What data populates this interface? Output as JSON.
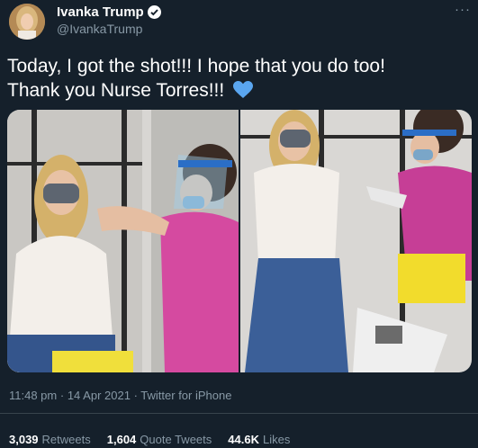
{
  "author": {
    "name": "Ivanka Trump",
    "handle": "@IvankaTrump",
    "verified": true
  },
  "menu_icon": "more-icon",
  "tweet": {
    "line1": "Today, I got the shot!!! I hope that you do too!",
    "line2": "Thank you Nurse Torres!!!",
    "emoji": "blue-heart"
  },
  "media": {
    "count": 2
  },
  "meta": {
    "time": "11:48 pm",
    "date": "14 Apr 2021",
    "source": "Twitter for iPhone"
  },
  "stats": {
    "retweets_value": "3,039",
    "retweets_label": "Retweets",
    "quotes_value": "1,604",
    "quotes_label": "Quote Tweets",
    "likes_value": "44.6K",
    "likes_label": "Likes"
  },
  "colors": {
    "background": "#15202b",
    "text": "#ffffff",
    "secondary": "#8899a6",
    "heart": "#5aa6f0",
    "scrub": "#c63e96"
  }
}
